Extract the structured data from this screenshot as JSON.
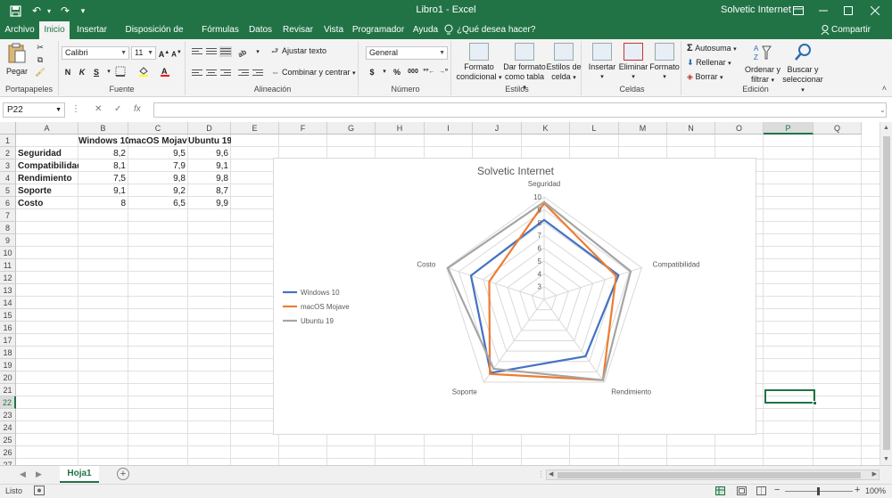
{
  "window": {
    "title": "Libro1 - Excel",
    "account": "Solvetic Internet",
    "share": "Compartir",
    "tell_me": "¿Qué desea hacer?"
  },
  "tabs": [
    "Archivo",
    "Inicio",
    "Insertar",
    "Disposición de página",
    "Fórmulas",
    "Datos",
    "Revisar",
    "Vista",
    "Programador",
    "Ayuda"
  ],
  "ribbon": {
    "portapapeles": {
      "label": "Portapapeles",
      "paste": "Pegar"
    },
    "fuente": {
      "label": "Fuente",
      "font": "Calibri",
      "size": "11",
      "bold": "N",
      "italic": "K",
      "underline": "S"
    },
    "alineacion": {
      "label": "Alineación",
      "wrap": "Ajustar texto",
      "merge": "Combinar y centrar"
    },
    "numero": {
      "label": "Número",
      "format": "General",
      "percent": "%",
      "thousands": "000"
    },
    "estilos": {
      "label": "Estilos",
      "cond_l1": "Formato",
      "cond_l2": "condicional",
      "table_l1": "Dar formato",
      "table_l2": "como tabla",
      "cell_l1": "Estilos de",
      "cell_l2": "celda"
    },
    "celdas": {
      "label": "Celdas",
      "insert": "Insertar",
      "delete": "Eliminar",
      "format": "Formato"
    },
    "edicion": {
      "label": "Edición",
      "autosum": "Autosuma",
      "fill": "Rellenar",
      "clear": "Borrar",
      "sort_l1": "Ordenar y",
      "sort_l2": "filtrar",
      "find_l1": "Buscar y",
      "find_l2": "seleccionar"
    }
  },
  "formula_bar": {
    "name_box": "P22",
    "cancel": "✕",
    "enter": "✓",
    "fx": "fx",
    "value": ""
  },
  "sheet": {
    "columns": [
      "A",
      "B",
      "C",
      "D",
      "E",
      "F",
      "G",
      "H",
      "I",
      "J",
      "K",
      "L",
      "M",
      "N",
      "O",
      "P",
      "Q"
    ],
    "selected_column": "P",
    "selected_row": 22,
    "rows": [
      1,
      2,
      3,
      4,
      5,
      6,
      7,
      8,
      9,
      10,
      11,
      12,
      13,
      14,
      15,
      16,
      17,
      18,
      19,
      20,
      21,
      22,
      23,
      24,
      25,
      26,
      27
    ],
    "table": {
      "headers": [
        "",
        "Windows 10",
        "macOS Mojave",
        "Ubuntu 19"
      ],
      "body": [
        [
          "Seguridad",
          "8,2",
          "9,5",
          "9,6"
        ],
        [
          "Compatibilidad",
          "8,1",
          "7,9",
          "9,1"
        ],
        [
          "Rendimiento",
          "7,5",
          "9,8",
          "9,8"
        ],
        [
          "Soporte",
          "9,1",
          "9,2",
          "8,7"
        ],
        [
          "Costo",
          "8",
          "6,5",
          "9,9"
        ]
      ]
    }
  },
  "chart_data": {
    "type": "radar",
    "title": "Solvetic Internet",
    "categories": [
      "Seguridad",
      "Compatibilidad",
      "Rendimiento",
      "Soporte",
      "Costo"
    ],
    "range": [
      2,
      10
    ],
    "ticks": [
      "3",
      "4",
      "5",
      "6",
      "7",
      "8",
      "9",
      "10"
    ],
    "grid": true,
    "legend_position": "left",
    "series": [
      {
        "name": "Windows 10",
        "values": [
          8.2,
          8.1,
          7.5,
          9.1,
          8
        ],
        "color": "#4472C4"
      },
      {
        "name": "macOS Mojave",
        "values": [
          9.5,
          7.9,
          9.8,
          9.2,
          6.5
        ],
        "color": "#ED7D31"
      },
      {
        "name": "Ubuntu 19",
        "values": [
          9.6,
          9.1,
          9.8,
          8.7,
          9.9
        ],
        "color": "#A5A5A5"
      }
    ]
  },
  "sheet_tabs": {
    "active": "Hoja1",
    "add": "+"
  },
  "status": {
    "ready": "Listo",
    "zoom": "100%",
    "minus": "−",
    "plus": "+"
  },
  "colors": {
    "excel_green": "#217346"
  }
}
